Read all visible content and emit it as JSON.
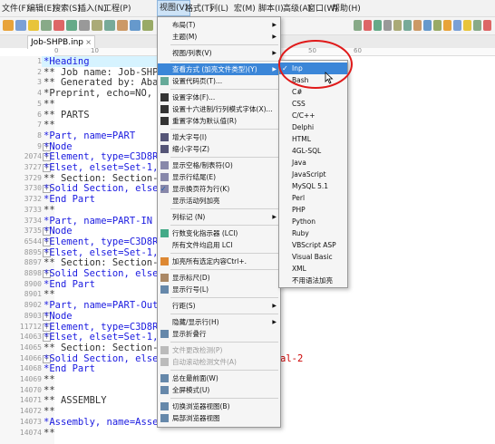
{
  "menubar": {
    "items": [
      "文件(F)",
      "编辑(E)",
      "搜索(S)",
      "插入(N)",
      "工程(P)",
      "视图(V)",
      "格式(T)",
      "列(L)",
      "宏(M)",
      "脚本(I)",
      "高级(A)",
      "窗口(W)",
      "帮助(H)"
    ],
    "active": "视图(V)"
  },
  "tab": {
    "label": "Job-SHPB.inp",
    "close": "×"
  },
  "ruler": {
    "ticks": [
      "0",
      "10",
      "50",
      "60"
    ]
  },
  "lines": [
    {
      "n": "1",
      "t": "*Heading",
      "c": "#1a1ae0",
      "fold": ""
    },
    {
      "n": "2",
      "t": "** Job name: Job-SHPB",
      "c": "#333",
      "fold": ""
    },
    {
      "n": "3",
      "t": "** Generated by: Abaq",
      "c": "#333",
      "fold": ""
    },
    {
      "n": "4",
      "t": "*Preprint, echo=NO, m",
      "c": "#333",
      "fold": ""
    },
    {
      "n": "5",
      "t": "**",
      "c": "#333",
      "fold": ""
    },
    {
      "n": "6",
      "t": "** PARTS",
      "c": "#333",
      "fold": ""
    },
    {
      "n": "7",
      "t": "**",
      "c": "#333",
      "fold": ""
    },
    {
      "n": "8",
      "t": "*Part, name=PART",
      "c": "#1a1ae0",
      "fold": ""
    },
    {
      "n": "9",
      "t": "*Node",
      "c": "#1a1ae0",
      "fold": "+"
    },
    {
      "n": "2074",
      "t": "*Element, type=C3D8R",
      "c": "#1a1ae0",
      "fold": "+"
    },
    {
      "n": "3727",
      "t": "*Elset, elset=Set-1,",
      "c": "#1a1ae0",
      "fold": "+"
    },
    {
      "n": "3729",
      "t": "** Section: Section-1",
      "c": "#333",
      "fold": ""
    },
    {
      "n": "3730",
      "t": "*Solid Section, elset",
      "c": "#1a1ae0",
      "fold": "+"
    },
    {
      "n": "3732",
      "t": "*End Part",
      "c": "#1a1ae0",
      "fold": ""
    },
    {
      "n": "3733",
      "t": "**",
      "c": "#333",
      "fold": ""
    },
    {
      "n": "3734",
      "t": "*Part, name=PART-IN",
      "c": "#1a1ae0",
      "fold": ""
    },
    {
      "n": "3735",
      "t": "*Node",
      "c": "#1a1ae0",
      "fold": "+"
    },
    {
      "n": "6544",
      "t": "*Element, type=C3D8R",
      "c": "#1a1ae0",
      "fold": "+"
    },
    {
      "n": "8895",
      "t": "*Elset, elset=Set-1,",
      "c": "#1a1ae0",
      "fold": "+"
    },
    {
      "n": "8897",
      "t": "** Section: Section-2",
      "c": "#333",
      "fold": ""
    },
    {
      "n": "8898",
      "t": "*Solid Section, elset",
      "c": "#1a1ae0",
      "fold": "+"
    },
    {
      "n": "8900",
      "t": "*End Part",
      "c": "#1a1ae0",
      "fold": ""
    },
    {
      "n": "8901",
      "t": "**",
      "c": "#333",
      "fold": ""
    },
    {
      "n": "8902",
      "t": "*Part, name=PART-Out",
      "c": "#1a1ae0",
      "fold": ""
    },
    {
      "n": "8903",
      "t": "*Node",
      "c": "#1a1ae0",
      "fold": "+"
    },
    {
      "n": "11712",
      "t": "*Element, type=C3D8R",
      "c": "#1a1ae0",
      "fold": "+"
    },
    {
      "n": "14063",
      "t": "*Elset, elset=Set-1,",
      "c": "#1a1ae0",
      "fold": "+"
    },
    {
      "n": "14065",
      "t": "** Section: Section-2",
      "c": "#333",
      "fold": ""
    },
    {
      "n": "14066",
      "t": "*Solid Section, elset",
      "c": "#1a1ae0",
      "fold": "+"
    },
    {
      "n": "14068",
      "t": "*End Part",
      "c": "#1a1ae0",
      "fold": ""
    },
    {
      "n": "14069",
      "t": "**",
      "c": "#333",
      "fold": ""
    },
    {
      "n": "14070",
      "t": "**",
      "c": "#333",
      "fold": ""
    },
    {
      "n": "14071",
      "t": "** ASSEMBLY",
      "c": "#333",
      "fold": ""
    },
    {
      "n": "14072",
      "t": "**",
      "c": "#333",
      "fold": ""
    },
    {
      "n": "14073",
      "t": "*Assembly, name=Assembly",
      "c": "#1a1ae0",
      "fold": ""
    },
    {
      "n": "14074",
      "t": "**",
      "c": "#333",
      "fold": ""
    }
  ],
  "code_tail": {
    "line14066": "al-2"
  },
  "view_menu": [
    {
      "label": "布局(T)",
      "arrow": true
    },
    {
      "label": "主题(M)",
      "arrow": true
    },
    {
      "sep": true
    },
    {
      "label": "视图/列表(V)",
      "arrow": true
    },
    {
      "sep": true
    },
    {
      "label": "查看方式 (加亮文件类型)(Y)",
      "arrow": true,
      "sel": true
    },
    {
      "label": "设置代码页(T)...",
      "icon": "#6a9"
    },
    {
      "sep": true
    },
    {
      "label": "设置字体(F)...",
      "icon": "#333"
    },
    {
      "label": "设置十六进制/行列模式字体(X)...",
      "icon": "#333"
    },
    {
      "label": "重置字体为默认值(R)",
      "icon": "#333"
    },
    {
      "sep": true
    },
    {
      "label": "增大字号(I)",
      "icon": "#557"
    },
    {
      "label": "缩小字号(Z)",
      "icon": "#557"
    },
    {
      "sep": true
    },
    {
      "label": "显示空格/制表符(O)",
      "icon": "#88a"
    },
    {
      "label": "显示行结尾(E)",
      "icon": "#88a"
    },
    {
      "label": "显示换页符为行(K)",
      "icon": "#88a",
      "check": true
    },
    {
      "label": "显示活动列加亮",
      "icon": ""
    },
    {
      "sep": true
    },
    {
      "label": "列标记 (N)",
      "arrow": true
    },
    {
      "sep": true
    },
    {
      "label": "行数变化指示器 (LCI)",
      "icon": "#4a8"
    },
    {
      "label": "所有文件均启用 LCI",
      "icon": ""
    },
    {
      "sep": true
    },
    {
      "label": "加亮所有选定内容Ctrl+.",
      "shortcut": "Ctrl+.",
      "icon": "#d83"
    },
    {
      "sep": true
    },
    {
      "label": "显示标尺(D)",
      "icon": "#a86"
    },
    {
      "label": "显示行号(L)",
      "icon": "#68a"
    },
    {
      "sep": true
    },
    {
      "label": "行距(S)",
      "arrow": true
    },
    {
      "sep": true
    },
    {
      "label": "隐藏/显示行(H)",
      "arrow": true
    },
    {
      "label": "显示折叠行",
      "icon": "#68a"
    },
    {
      "sep": true
    },
    {
      "label": "文件更改检测(P)",
      "dis": true,
      "icon": "#bbb"
    },
    {
      "label": "自动滚动检测文件(A)",
      "dis": true,
      "icon": "#bbb"
    },
    {
      "sep": true
    },
    {
      "label": "总在最前面(W)",
      "icon": "#68a"
    },
    {
      "label": "全屏模式(U)",
      "icon": "#68a"
    },
    {
      "sep": true
    },
    {
      "label": "切换浏览器视图(B)",
      "icon": "#68a"
    },
    {
      "label": "局部浏览器视图",
      "icon": "#68a"
    }
  ],
  "submenu": [
    "Inp",
    "Bash",
    "C#",
    "CSS",
    "C/C++",
    "Delphi",
    "HTML",
    "4GL-SQL",
    "Java",
    "JavaScript",
    "MySQL 5.1",
    "Perl",
    "PHP",
    "Python",
    "Ruby",
    "VBScript ASP",
    "Visual Basic",
    "XML",
    "不用语法加亮"
  ],
  "submenu_checked": "Inp",
  "colors": {
    "accent": "#3b86d8",
    "highlight_circle": "#e01a1a",
    "keyword": "#1a1ae0",
    "string_red": "#cc0000"
  }
}
